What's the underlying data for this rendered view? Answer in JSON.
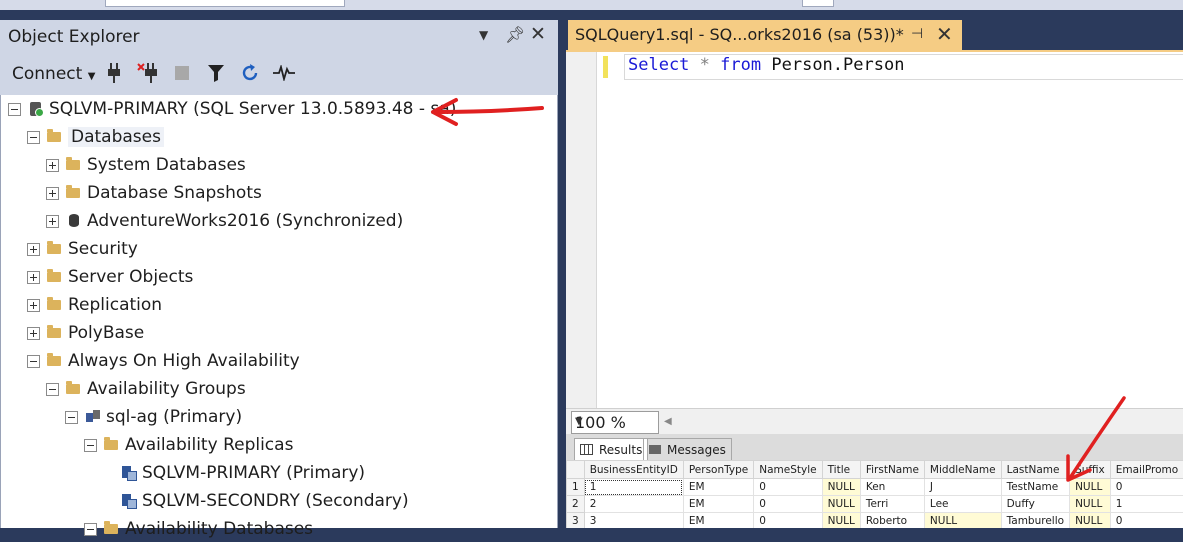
{
  "object_explorer": {
    "title": "Object Explorer",
    "toolbar": {
      "connect_label": "Connect"
    },
    "tree": [
      {
        "label": "SQLVM-PRIMARY (SQL Server 13.0.5893.48 - sa)",
        "icon": "server-icon"
      },
      {
        "label": "Databases",
        "icon": "folder-icon"
      },
      {
        "label": "System Databases",
        "icon": "folder-icon"
      },
      {
        "label": "Database Snapshots",
        "icon": "folder-icon"
      },
      {
        "label": "AdventureWorks2016 (Synchronized)",
        "icon": "database-icon"
      },
      {
        "label": "Security",
        "icon": "folder-icon"
      },
      {
        "label": "Server Objects",
        "icon": "folder-icon"
      },
      {
        "label": "Replication",
        "icon": "folder-icon"
      },
      {
        "label": "PolyBase",
        "icon": "folder-icon"
      },
      {
        "label": "Always On High Availability",
        "icon": "folder-icon"
      },
      {
        "label": "Availability Groups",
        "icon": "folder-icon"
      },
      {
        "label": "sql-ag (Primary)",
        "icon": "availability-group-icon"
      },
      {
        "label": "Availability Replicas",
        "icon": "folder-icon"
      },
      {
        "label": "SQLVM-PRIMARY (Primary)",
        "icon": "replica-icon"
      },
      {
        "label": "SQLVM-SECONDRY (Secondary)",
        "icon": "replica-icon"
      },
      {
        "label": "Availability Databases",
        "icon": "folder-icon"
      }
    ]
  },
  "editor": {
    "tab_title": "SQLQuery1.sql - SQ...orks2016 (sa (53))*",
    "query": {
      "kw1": "Select",
      "star": "*",
      "kw2": "from",
      "rest": "Person.Person"
    },
    "zoom": "100 %"
  },
  "results": {
    "tabs": [
      "Results",
      "Messages"
    ],
    "columns": [
      "BusinessEntityID",
      "PersonType",
      "NameStyle",
      "Title",
      "FirstName",
      "MiddleName",
      "LastName",
      "Suffix",
      "EmailPromo"
    ],
    "rows": [
      [
        "1",
        "1",
        "EM",
        "0",
        "NULL",
        "Ken",
        "J",
        "TestName",
        "NULL",
        "0"
      ],
      [
        "2",
        "2",
        "EM",
        "0",
        "NULL",
        "Terri",
        "Lee",
        "Duffy",
        "NULL",
        "1"
      ],
      [
        "3",
        "3",
        "EM",
        "0",
        "NULL",
        "Roberto",
        "NULL",
        "Tamburello",
        "NULL",
        "0"
      ]
    ]
  },
  "colors": {
    "accent_tab": "#f5cc84",
    "chrome": "#cfd6e5",
    "frame": "#2b3a5c",
    "annotation_arrow": "#e02020",
    "keyword": "#1a1ad6"
  }
}
